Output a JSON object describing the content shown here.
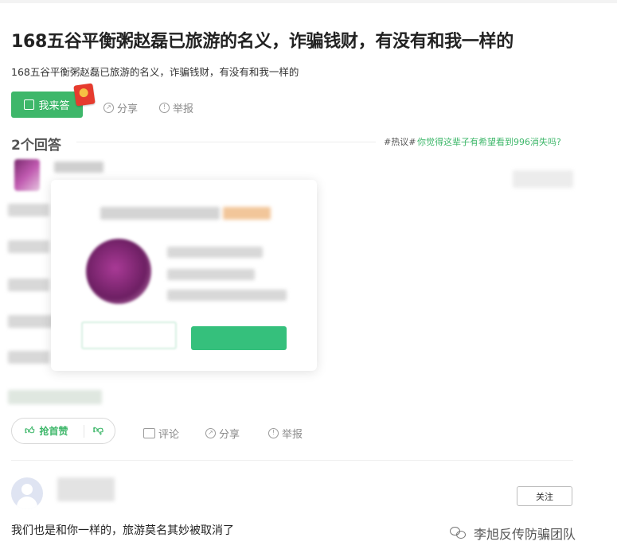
{
  "question": {
    "title": "168五谷平衡粥赵磊已旅游的名义，诈骗钱财，有没有和我一样的",
    "description": "168五谷平衡粥赵磊已旅游的名义，诈骗钱财，有没有和我一样的"
  },
  "toolbar": {
    "answer_label": "我来答",
    "share_label": "分享",
    "report_label": "举报"
  },
  "answers_header": {
    "count_label": "2个回答",
    "hot_tag": "#热议#",
    "hot_link": "你觉得这辈子有希望看到996消失吗?"
  },
  "answer_actions": {
    "like_label": "抢首赞",
    "comment_label": "评论",
    "share_label": "分享",
    "report_label": "举报"
  },
  "second_answer": {
    "follow_label": "关注",
    "text": "我们也是和你一样的，旅游莫名其妙被取消了"
  },
  "watermark": {
    "text": "李旭反传防骗团队"
  },
  "colors": {
    "brand_green": "#3eb76a",
    "popup_green": "#35c07c",
    "red_packet": "#e63b2e"
  }
}
